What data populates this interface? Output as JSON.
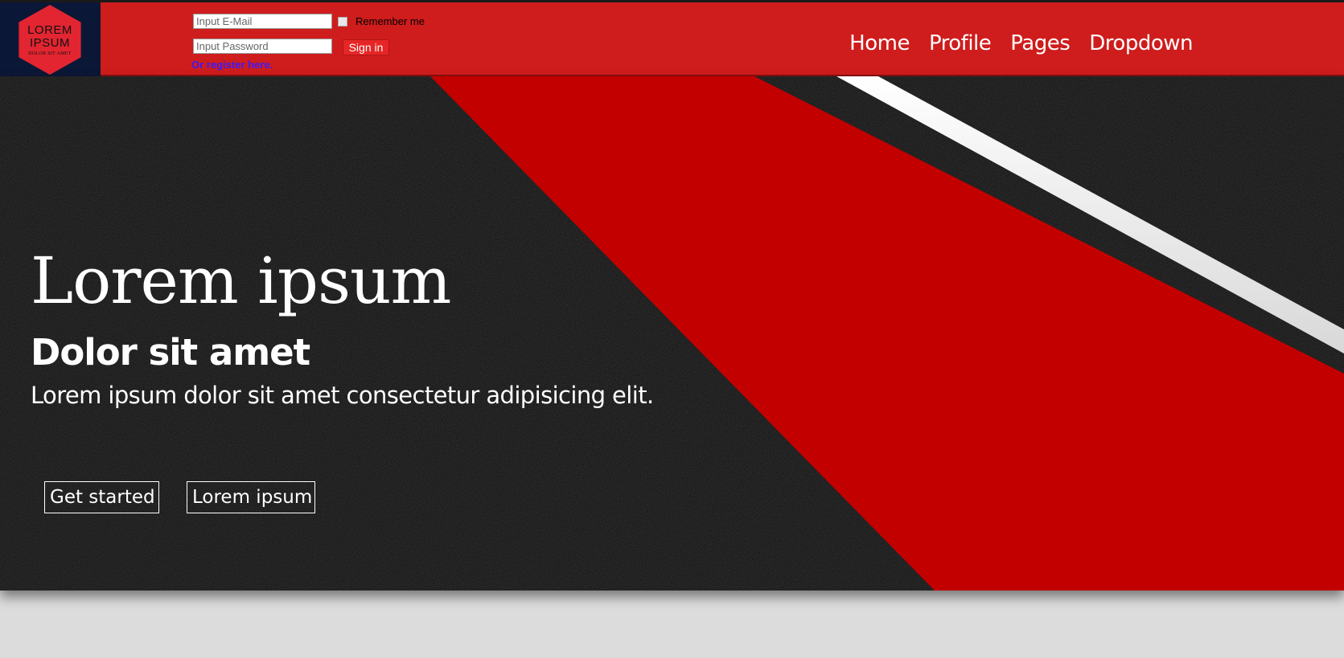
{
  "logo": {
    "line1": "LOREM",
    "line2": "IPSUM",
    "line3": "DOLOR SIT AMET"
  },
  "login": {
    "email_placeholder": "Input E-Mail",
    "password_placeholder": "Input Password",
    "remember_label": "Remember me",
    "signin_label": "Sign in",
    "register_label": "Or register here."
  },
  "nav": {
    "items": [
      {
        "label": "Home"
      },
      {
        "label": "Profile"
      },
      {
        "label": "Pages"
      },
      {
        "label": "Dropdown"
      }
    ]
  },
  "hero": {
    "title": "Lorem ipsum",
    "subtitle": "Dolor sit amet",
    "text": "Lorem ipsum dolor sit amet consectetur adipisicing elit.",
    "buttons": {
      "primary": "Get started",
      "secondary": "Lorem ipsum"
    }
  },
  "colors": {
    "header": "#cf1c1c",
    "logo_bg": "#0b1736",
    "logo_hex": "#e32531",
    "hero_bg": "#0d0d0d",
    "hero_red": "#c00000",
    "page_bg": "#dcdcdc"
  }
}
